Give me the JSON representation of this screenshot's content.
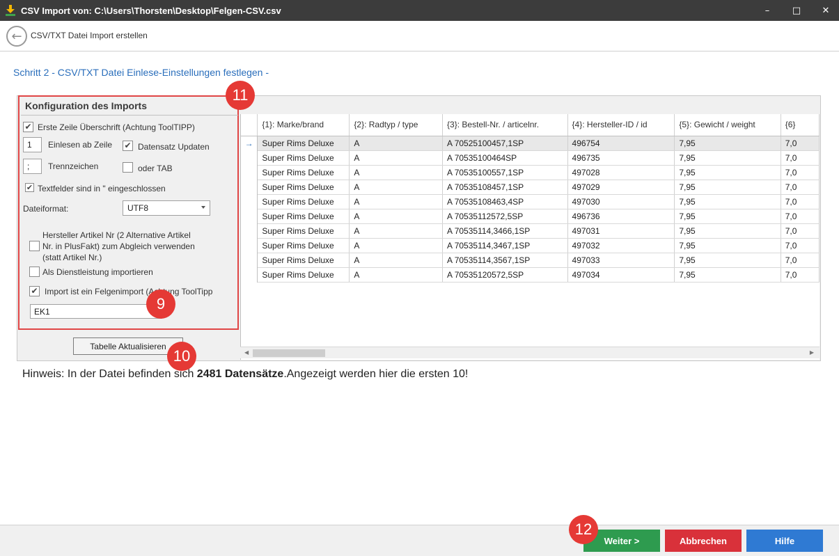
{
  "window": {
    "title": "CSV Import von: C:\\Users\\Thorsten\\Desktop\\Felgen-CSV.csv",
    "minimize": "–",
    "maximize": "□",
    "close": "✕"
  },
  "nav": {
    "back_icon": "←",
    "title": "CSV/TXT Datei Import erstellen"
  },
  "step_title": "Schritt 2 - CSV/TXT Datei Einlese-Einstellungen festlegen -",
  "config": {
    "header": "Konfiguration des Imports",
    "first_row_header": {
      "label": "Erste Zeile Überschrift (Achtung ToolTIPP)",
      "checked": true
    },
    "start_row": {
      "value": "1",
      "label": "Einlesen ab Zeile"
    },
    "update_records": {
      "label": "Datensatz Updaten",
      "checked": true
    },
    "separator": {
      "value": ";",
      "label": "Trennzeichen"
    },
    "or_tab": {
      "label": "oder TAB",
      "checked": false
    },
    "text_quoted": {
      "label": "Textfelder sind in \" eingeschlossen",
      "checked": true
    },
    "file_format": {
      "label": "Dateiformat:",
      "value": "UTF8"
    },
    "manufacturer_article": {
      "line1": "Hersteller Artikel Nr (2 Alternative Artikel",
      "line2": "Nr. in PlusFakt) zum Abgleich verwenden",
      "line3": "(statt Artikel Nr.)",
      "checked": false
    },
    "as_service": {
      "label": "Als Dienstleistung importieren",
      "checked": false
    },
    "rim_import": {
      "label": "Import ist ein Felgenimport (Achtung ToolTipp",
      "checked": true
    },
    "price_field": "EK1",
    "refresh_button": "Tabelle Aktualisieren"
  },
  "badges": {
    "b11": "11",
    "b9": "9",
    "b10": "10",
    "b12": "12"
  },
  "grid": {
    "row_indicator": "→",
    "columns": [
      "{1}: Marke/brand",
      "{2}: Radtyp / type",
      "{3}: Bestell-Nr. / articelnr.",
      "{4}: Hersteller-ID / id",
      "{5}: Gewicht / weight",
      "{6}"
    ],
    "rows": [
      [
        "Super Rims Deluxe",
        "A",
        "A 70525100457,1SP",
        "496754",
        "7,95",
        "7,0"
      ],
      [
        "Super Rims Deluxe",
        "A",
        "A 70535100464SP",
        "496735",
        "7,95",
        "7,0"
      ],
      [
        "Super Rims Deluxe",
        "A",
        "A 70535100557,1SP",
        "497028",
        "7,95",
        "7,0"
      ],
      [
        "Super Rims Deluxe",
        "A",
        "A 70535108457,1SP",
        "497029",
        "7,95",
        "7,0"
      ],
      [
        "Super Rims Deluxe",
        "A",
        "A 70535108463,4SP",
        "497030",
        "7,95",
        "7,0"
      ],
      [
        "Super Rims Deluxe",
        "A",
        "A 70535112572,5SP",
        "496736",
        "7,95",
        "7,0"
      ],
      [
        "Super Rims Deluxe",
        "A",
        "A 70535114,3466,1SP",
        "497031",
        "7,95",
        "7,0"
      ],
      [
        "Super Rims Deluxe",
        "A",
        "A 70535114,3467,1SP",
        "497032",
        "7,95",
        "7,0"
      ],
      [
        "Super Rims Deluxe",
        "A",
        "A 70535114,3567,1SP",
        "497033",
        "7,95",
        "7,0"
      ],
      [
        "Super Rims Deluxe",
        "A",
        "A 70535120572,5SP",
        "497034",
        "7,95",
        "7,0"
      ]
    ],
    "scroll_left": "◀",
    "scroll_right": "▶"
  },
  "hint": {
    "prefix": "Hinweis: In der Datei befinden sich ",
    "count": "2481 Datensätze",
    "suffix": ".Angezeigt werden hier die ersten 10!"
  },
  "footer": {
    "next": "Weiter >",
    "cancel": "Abbrechen",
    "help": "Hilfe"
  },
  "colors": {
    "titlebar": "#3c3c3c",
    "accent_blue": "#2a6ebb",
    "next": "#2e9b4f",
    "cancel": "#d9313a",
    "help": "#2f7ad3",
    "highlight_red": "#e04545"
  }
}
